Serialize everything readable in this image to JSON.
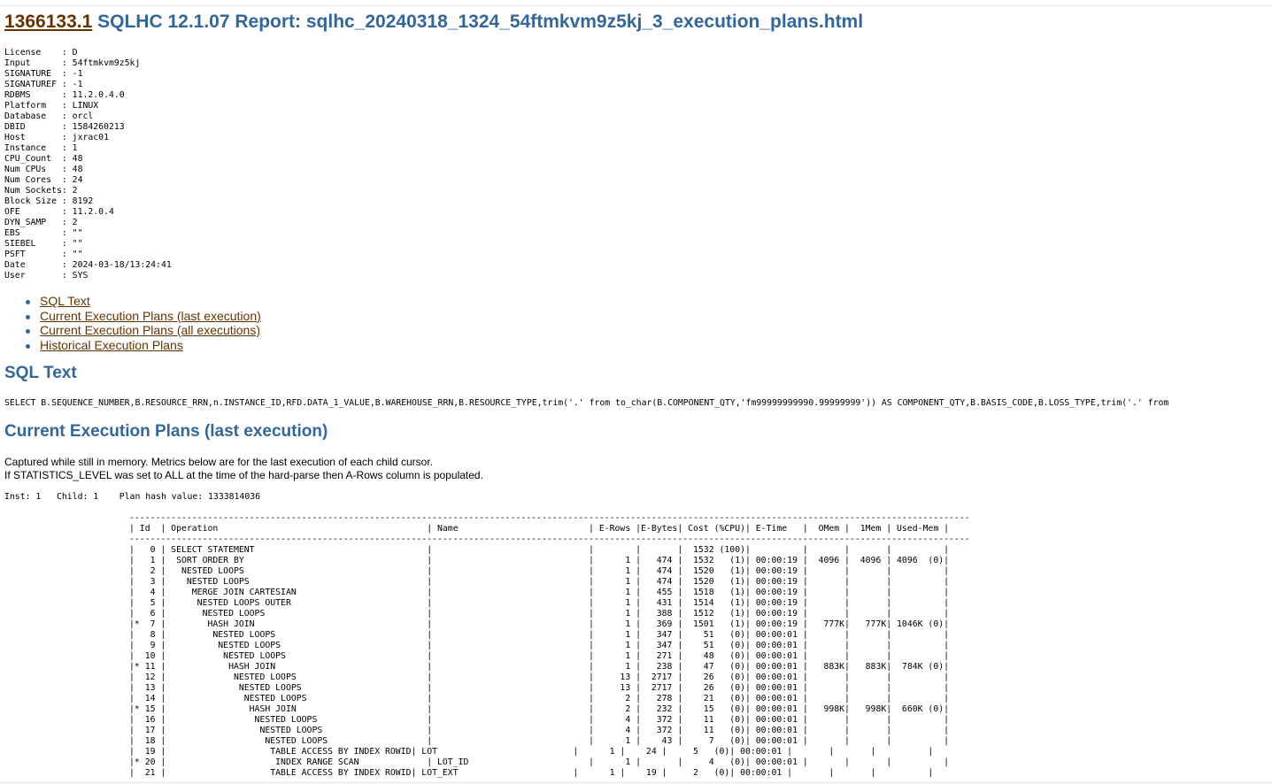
{
  "report": {
    "note_id": "1366133.1",
    "title": "SQLHC 12.1.07 Report: sqlhc_20240318_1324_54ftmkvm9z5kj_3_execution_plans.html"
  },
  "header_lines": [
    "License    : D",
    "Input      : 54ftmkvm9z5kj",
    "SIGNATURE  : -1",
    "SIGNATUREF : -1",
    "RDBMS      : 11.2.0.4.0",
    "Platform   : LINUX",
    "Database   : orcl",
    "DBID       : 1584260213",
    "Host       : jxrac01",
    "Instance   : 1",
    "CPU_Count  : 48",
    "Num CPUs   : 48",
    "Num Cores  : 24",
    "Num Sockets: 2",
    "Block Size : 8192",
    "OFE        : 11.2.0.4",
    "DYN_SAMP   : 2",
    "EBS        : \"\"",
    "SIEBEL     : \"\"",
    "PSFT       : \"\"",
    "Date       : 2024-03-18/13:24:41",
    "User       : SYS"
  ],
  "toc": [
    "SQL Text",
    "Current Execution Plans (last execution)",
    "Current Execution Plans (all executions)",
    "Historical Execution Plans"
  ],
  "sql_section": {
    "heading": "SQL Text",
    "text": "SELECT B.SEQUENCE_NUMBER,B.RESOURCE_RRN,n.INSTANCE_ID,RFD.DATA_1_VALUE,B.WAREHOUSE_RRN,B.RESOURCE_TYPE,trim('.' from to_char(B.COMPONENT_QTY,'fm99999999990.99999999')) AS COMPONENT_QTY,B.BASIS_CODE,B.LOSS_TYPE,trim('.' from"
  },
  "plans_section": {
    "heading": "Current Execution Plans (last execution)",
    "desc_1": "Captured while still in memory. Metrics below are for the last execution of each child cursor.",
    "desc_2": "If STATISTICS_LEVEL was set to ALL at the time of the hard-parse then A-Rows column is populated.",
    "inst_line": "Inst: 1   Child: 1    Plan hash value: 1333814036"
  },
  "plan_lines": [
    "-----------------------------------------------------------------------------------------------------------------------------------------------------------------",
    "| Id  | Operation                                        | Name                         | E-Rows |E-Bytes| Cost (%CPU)| E-Time   |  OMem |  1Mem | Used-Mem |",
    "-----------------------------------------------------------------------------------------------------------------------------------------------------------------",
    "|   0 | SELECT STATEMENT                                 |                              |        |       |  1532 (100)|          |       |       |          |",
    "|   1 |  SORT ORDER BY                                   |                              |      1 |   474 |  1532   (1)| 00:00:19 |  4096 |  4096 | 4096  (0)|",
    "|   2 |   NESTED LOOPS                                   |                              |      1 |   474 |  1520   (1)| 00:00:19 |       |       |          |",
    "|   3 |    NESTED LOOPS                                  |                              |      1 |   474 |  1520   (1)| 00:00:19 |       |       |          |",
    "|   4 |     MERGE JOIN CARTESIAN                         |                              |      1 |   455 |  1518   (1)| 00:00:19 |       |       |          |",
    "|   5 |      NESTED LOOPS OUTER                          |                              |      1 |   431 |  1514   (1)| 00:00:19 |       |       |          |",
    "|   6 |       NESTED LOOPS                               |                              |      1 |   388 |  1512   (1)| 00:00:19 |       |       |          |",
    "|*  7 |        HASH JOIN                                 |                              |      1 |   369 |  1501   (1)| 00:00:19 |   777K|   777K| 1046K (0)|",
    "|   8 |         NESTED LOOPS                             |                              |      1 |   347 |    51   (0)| 00:00:01 |       |       |          |",
    "|   9 |          NESTED LOOPS                            |                              |      1 |   347 |    51   (0)| 00:00:01 |       |       |          |",
    "|  10 |           NESTED LOOPS                           |                              |      1 |   271 |    48   (0)| 00:00:01 |       |       |          |",
    "|* 11 |            HASH JOIN                             |                              |      1 |   238 |    47   (0)| 00:00:01 |   883K|   883K|  784K (0)|",
    "|  12 |             NESTED LOOPS                         |                              |     13 |  2717 |    26   (0)| 00:00:01 |       |       |          |",
    "|  13 |              NESTED LOOPS                        |                              |     13 |  2717 |    26   (0)| 00:00:01 |       |       |          |",
    "|  14 |               NESTED LOOPS                       |                              |      2 |   278 |    21   (0)| 00:00:01 |       |       |          |",
    "|* 15 |                HASH JOIN                         |                              |      2 |   232 |    15   (0)| 00:00:01 |   998K|   998K|  660K (0)|",
    "|  16 |                 NESTED LOOPS                     |                              |      4 |   372 |    11   (0)| 00:00:01 |       |       |          |",
    "|  17 |                  NESTED LOOPS                    |                              |      4 |   372 |    11   (0)| 00:00:01 |       |       |          |",
    "|  18 |                   NESTED LOOPS                   |                              |      1 |    43 |     7   (0)| 00:00:01 |       |       |          |",
    "|  19 |                    TABLE ACCESS BY INDEX ROWID| LOT                          |      1 |    24 |     5   (0)| 00:00:01 |       |       |          |",
    "|* 20 |                     INDEX RANGE SCAN             | LOT_ID                       |      1 |       |     4   (0)| 00:00:01 |       |       |          |",
    "|  21 |                    TABLE ACCESS BY INDEX ROWID| LOT_EXT                      |      1 |    19 |     2   (0)| 00:00:01 |       |       |          |"
  ]
}
